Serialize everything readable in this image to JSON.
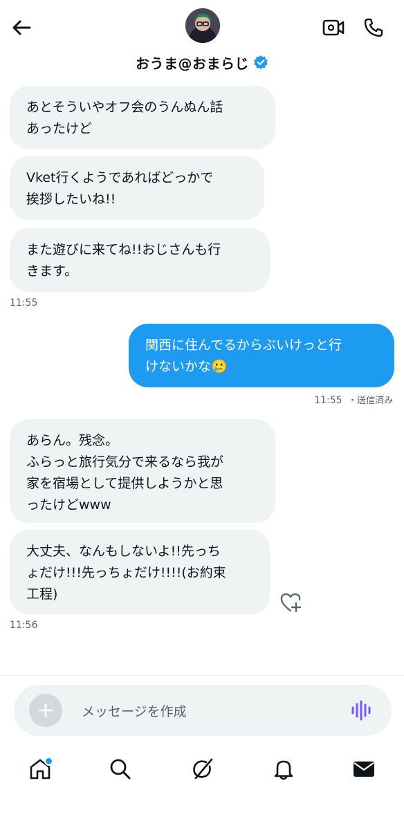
{
  "header": {
    "title": "おうま@おまらじ",
    "back_icon": "arrow-left-icon",
    "video_icon": "video-call-icon",
    "phone_icon": "phone-icon",
    "verified_icon": "verified-badge-icon"
  },
  "messages": [
    {
      "dir": "in",
      "text": "あとそういやオフ会のうんぬん話\nあったけど"
    },
    {
      "dir": "in",
      "text": "Vket行くようであればどっかで\n挨拶したいね!!"
    },
    {
      "dir": "in",
      "text": "また遊びに来てね!!おじさんも行\nきます。"
    },
    {
      "dir": "out",
      "text": "関西に住んでるからぶいけっと行\nけないかな🥲"
    },
    {
      "dir": "in",
      "text": "あらん。残念。\nふらっと旅行気分で来るなら我が\n家を宿場として提供しようかと思\nったけどwww"
    },
    {
      "dir": "in",
      "text": "大丈夫、なんもしないよ!!先っち\nょだけ!!!先っちょだけ!!!!(お約束\n工程)"
    }
  ],
  "timestamps": {
    "t1": "11:55",
    "t2": "11:55",
    "t2_status": "・送信済み",
    "t3": "11:56"
  },
  "composer": {
    "placeholder": "メッセージを作成",
    "plus_icon": "plus-icon",
    "voice_icon": "voice-wave-icon"
  },
  "tabbar": {
    "items": [
      "home-icon",
      "search-icon",
      "grok-icon",
      "bell-icon",
      "mail-icon"
    ],
    "notification_dot_color": "#1d9bf0"
  },
  "colors": {
    "accent": "#1d9bf0",
    "incoming_bubble": "#eff3f4",
    "voice_accent": "#7856ff"
  }
}
